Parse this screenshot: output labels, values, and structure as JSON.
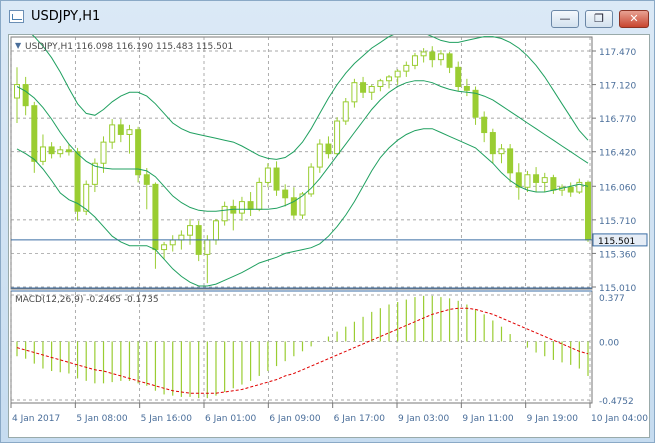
{
  "window": {
    "title": "USDJPY,H1",
    "minimize_icon": "minimize-icon",
    "restore_icon": "restore-icon",
    "close_icon": "close-icon"
  },
  "main_panel": {
    "info_label": "USDJPY,H1  116.098 116.190 115.483 115.501",
    "price_ticks": [
      "117.470",
      "117.120",
      "116.770",
      "116.420",
      "116.060",
      "115.710",
      "115.360",
      "115.010"
    ],
    "current_price": "115.501"
  },
  "macd_panel": {
    "info_label": "MACD(12,26,9) -0.2465 -0.1735",
    "ticks": [
      "0.377",
      "0.00",
      "-0.4752"
    ]
  },
  "time_axis": [
    "4 Jan 2017",
    "5 Jan 08:00",
    "5 Jan 16:00",
    "6 Jan 01:00",
    "6 Jan 09:00",
    "6 Jan 17:00",
    "9 Jan 03:00",
    "9 Jan 11:00",
    "9 Jan 19:00",
    "10 Jan 04:00"
  ],
  "colors": {
    "bull": "#9acd32",
    "bear": "#9acd32",
    "bands": "#20a060",
    "signal": "#e00000",
    "grid": "#8a8a8a",
    "axis_text": "#4a6e9a"
  },
  "chart_data": {
    "type": "candlestick",
    "price_ylim": [
      115.01,
      117.47
    ],
    "candles": [
      {
        "o": 116.98,
        "h": 117.3,
        "l": 116.72,
        "c": 117.12
      },
      {
        "o": 117.12,
        "h": 117.2,
        "l": 116.8,
        "c": 116.9
      },
      {
        "o": 116.9,
        "h": 116.94,
        "l": 116.2,
        "c": 116.32
      },
      {
        "o": 116.32,
        "h": 116.6,
        "l": 116.28,
        "c": 116.47
      },
      {
        "o": 116.47,
        "h": 116.52,
        "l": 116.35,
        "c": 116.4
      },
      {
        "o": 116.4,
        "h": 116.48,
        "l": 116.36,
        "c": 116.44
      },
      {
        "o": 116.44,
        "h": 116.5,
        "l": 116.38,
        "c": 116.42
      },
      {
        "o": 116.42,
        "h": 116.46,
        "l": 115.7,
        "c": 115.8
      },
      {
        "o": 115.8,
        "h": 116.12,
        "l": 115.76,
        "c": 116.08
      },
      {
        "o": 116.08,
        "h": 116.35,
        "l": 116.0,
        "c": 116.3
      },
      {
        "o": 116.3,
        "h": 116.58,
        "l": 116.2,
        "c": 116.52
      },
      {
        "o": 116.52,
        "h": 116.76,
        "l": 116.45,
        "c": 116.7
      },
      {
        "o": 116.7,
        "h": 116.76,
        "l": 116.52,
        "c": 116.6
      },
      {
        "o": 116.6,
        "h": 116.7,
        "l": 116.4,
        "c": 116.65
      },
      {
        "o": 116.65,
        "h": 116.68,
        "l": 116.1,
        "c": 116.18
      },
      {
        "o": 116.18,
        "h": 116.25,
        "l": 115.82,
        "c": 116.08
      },
      {
        "o": 116.08,
        "h": 116.1,
        "l": 115.2,
        "c": 115.4
      },
      {
        "o": 115.4,
        "h": 115.48,
        "l": 115.3,
        "c": 115.45
      },
      {
        "o": 115.45,
        "h": 115.55,
        "l": 115.38,
        "c": 115.5
      },
      {
        "o": 115.5,
        "h": 115.6,
        "l": 115.4,
        "c": 115.55
      },
      {
        "o": 115.55,
        "h": 115.72,
        "l": 115.45,
        "c": 115.65
      },
      {
        "o": 115.65,
        "h": 115.7,
        "l": 115.28,
        "c": 115.35
      },
      {
        "o": 115.35,
        "h": 115.55,
        "l": 115.05,
        "c": 115.5
      },
      {
        "o": 115.5,
        "h": 115.72,
        "l": 115.45,
        "c": 115.7
      },
      {
        "o": 115.7,
        "h": 115.9,
        "l": 115.65,
        "c": 115.85
      },
      {
        "o": 115.85,
        "h": 115.92,
        "l": 115.6,
        "c": 115.78
      },
      {
        "o": 115.78,
        "h": 115.95,
        "l": 115.7,
        "c": 115.9
      },
      {
        "o": 115.9,
        "h": 116.0,
        "l": 115.75,
        "c": 115.82
      },
      {
        "o": 115.82,
        "h": 116.15,
        "l": 115.8,
        "c": 116.1
      },
      {
        "o": 116.1,
        "h": 116.3,
        "l": 116.05,
        "c": 116.25
      },
      {
        "o": 116.25,
        "h": 116.32,
        "l": 115.96,
        "c": 116.02
      },
      {
        "o": 116.02,
        "h": 116.08,
        "l": 115.85,
        "c": 115.94
      },
      {
        "o": 115.94,
        "h": 116.05,
        "l": 115.72,
        "c": 115.76
      },
      {
        "o": 115.76,
        "h": 116.0,
        "l": 115.72,
        "c": 115.98
      },
      {
        "o": 115.98,
        "h": 116.3,
        "l": 115.95,
        "c": 116.26
      },
      {
        "o": 116.26,
        "h": 116.55,
        "l": 116.2,
        "c": 116.5
      },
      {
        "o": 116.5,
        "h": 116.58,
        "l": 116.35,
        "c": 116.4
      },
      {
        "o": 116.4,
        "h": 116.78,
        "l": 116.38,
        "c": 116.74
      },
      {
        "o": 116.74,
        "h": 116.98,
        "l": 116.7,
        "c": 116.94
      },
      {
        "o": 116.94,
        "h": 117.18,
        "l": 116.88,
        "c": 117.14
      },
      {
        "o": 117.14,
        "h": 117.2,
        "l": 116.98,
        "c": 117.04
      },
      {
        "o": 117.04,
        "h": 117.12,
        "l": 116.96,
        "c": 117.1
      },
      {
        "o": 117.1,
        "h": 117.18,
        "l": 117.05,
        "c": 117.16
      },
      {
        "o": 117.16,
        "h": 117.22,
        "l": 117.08,
        "c": 117.2
      },
      {
        "o": 117.2,
        "h": 117.28,
        "l": 117.12,
        "c": 117.26
      },
      {
        "o": 117.26,
        "h": 117.36,
        "l": 117.2,
        "c": 117.32
      },
      {
        "o": 117.32,
        "h": 117.45,
        "l": 117.28,
        "c": 117.42
      },
      {
        "o": 117.42,
        "h": 117.5,
        "l": 117.35,
        "c": 117.46
      },
      {
        "o": 117.46,
        "h": 117.52,
        "l": 117.3,
        "c": 117.38
      },
      {
        "o": 117.38,
        "h": 117.48,
        "l": 117.32,
        "c": 117.44
      },
      {
        "o": 117.44,
        "h": 117.46,
        "l": 117.24,
        "c": 117.3
      },
      {
        "o": 117.3,
        "h": 117.36,
        "l": 117.05,
        "c": 117.1
      },
      {
        "o": 117.1,
        "h": 117.18,
        "l": 117.0,
        "c": 117.06
      },
      {
        "o": 117.06,
        "h": 117.1,
        "l": 116.7,
        "c": 116.78
      },
      {
        "o": 116.78,
        "h": 116.84,
        "l": 116.52,
        "c": 116.62
      },
      {
        "o": 116.62,
        "h": 116.66,
        "l": 116.3,
        "c": 116.4
      },
      {
        "o": 116.4,
        "h": 116.5,
        "l": 116.3,
        "c": 116.45
      },
      {
        "o": 116.45,
        "h": 116.5,
        "l": 116.1,
        "c": 116.2
      },
      {
        "o": 116.2,
        "h": 116.3,
        "l": 115.92,
        "c": 116.05
      },
      {
        "o": 116.05,
        "h": 116.22,
        "l": 116.0,
        "c": 116.18
      },
      {
        "o": 116.18,
        "h": 116.26,
        "l": 116.0,
        "c": 116.1
      },
      {
        "o": 116.1,
        "h": 116.2,
        "l": 116.0,
        "c": 116.15
      },
      {
        "o": 116.15,
        "h": 116.18,
        "l": 115.98,
        "c": 116.02
      },
      {
        "o": 116.02,
        "h": 116.08,
        "l": 115.96,
        "c": 116.05
      },
      {
        "o": 116.05,
        "h": 116.1,
        "l": 115.95,
        "c": 116.0
      },
      {
        "o": 116.0,
        "h": 116.14,
        "l": 115.98,
        "c": 116.1
      },
      {
        "o": 116.1,
        "h": 116.12,
        "l": 115.48,
        "c": 115.5
      }
    ],
    "bb_upper": [
      117.75,
      117.7,
      117.62,
      117.52,
      117.4,
      117.25,
      117.08,
      116.92,
      116.82,
      116.8,
      116.86,
      116.94,
      117.0,
      117.04,
      117.04,
      117.0,
      116.92,
      116.82,
      116.72,
      116.66,
      116.62,
      116.6,
      116.58,
      116.56,
      116.54,
      116.52,
      116.48,
      116.43,
      116.38,
      116.35,
      116.34,
      116.36,
      116.42,
      116.52,
      116.66,
      116.82,
      116.98,
      117.12,
      117.24,
      117.34,
      117.42,
      117.5,
      117.56,
      117.62,
      117.66,
      117.68,
      117.68,
      117.66,
      117.62,
      117.58,
      117.56,
      117.56,
      117.58,
      117.6,
      117.62,
      117.62,
      117.6,
      117.56,
      117.5,
      117.42,
      117.32,
      117.2,
      117.06,
      116.92,
      116.78,
      116.64,
      116.54
    ],
    "bb_middle": [
      117.1,
      117.05,
      116.98,
      116.88,
      116.76,
      116.62,
      116.5,
      116.4,
      116.32,
      116.27,
      116.25,
      116.24,
      116.24,
      116.24,
      116.24,
      116.22,
      116.16,
      116.06,
      115.96,
      115.89,
      115.84,
      115.81,
      115.8,
      115.8,
      115.81,
      115.82,
      115.82,
      115.82,
      115.82,
      115.82,
      115.83,
      115.86,
      115.9,
      115.96,
      116.04,
      116.14,
      116.26,
      116.38,
      116.5,
      116.62,
      116.74,
      116.86,
      116.96,
      117.04,
      117.1,
      117.14,
      117.16,
      117.16,
      117.14,
      117.1,
      117.07,
      117.05,
      117.04,
      117.03,
      117.0,
      116.96,
      116.9,
      116.84,
      116.78,
      116.72,
      116.66,
      116.6,
      116.54,
      116.48,
      116.42,
      116.36,
      116.3
    ],
    "bb_lower": [
      116.45,
      116.4,
      116.34,
      116.24,
      116.12,
      115.99,
      115.92,
      115.88,
      115.82,
      115.74,
      115.64,
      115.54,
      115.48,
      115.44,
      115.44,
      115.44,
      115.4,
      115.3,
      115.2,
      115.12,
      115.06,
      115.02,
      115.02,
      115.04,
      115.08,
      115.12,
      115.16,
      115.21,
      115.26,
      115.29,
      115.32,
      115.36,
      115.38,
      115.4,
      115.42,
      115.46,
      115.54,
      115.64,
      115.76,
      115.9,
      116.06,
      116.22,
      116.36,
      116.46,
      116.54,
      116.6,
      116.64,
      116.66,
      116.66,
      116.62,
      116.58,
      116.54,
      116.5,
      116.46,
      116.38,
      116.3,
      116.2,
      116.12,
      116.06,
      116.02,
      116.0,
      116.0,
      116.02,
      116.04,
      116.06,
      116.08,
      116.06
    ],
    "macd_ylim": [
      -0.4752,
      0.377
    ],
    "macd_hist": [
      -0.12,
      -0.14,
      -0.18,
      -0.22,
      -0.24,
      -0.25,
      -0.26,
      -0.3,
      -0.32,
      -0.34,
      -0.34,
      -0.33,
      -0.32,
      -0.32,
      -0.34,
      -0.36,
      -0.4,
      -0.43,
      -0.44,
      -0.45,
      -0.45,
      -0.46,
      -0.46,
      -0.44,
      -0.41,
      -0.38,
      -0.35,
      -0.32,
      -0.28,
      -0.24,
      -0.2,
      -0.16,
      -0.12,
      -0.08,
      -0.04,
      0.0,
      0.04,
      0.08,
      0.12,
      0.16,
      0.2,
      0.24,
      0.27,
      0.3,
      0.32,
      0.34,
      0.36,
      0.37,
      0.37,
      0.36,
      0.35,
      0.33,
      0.3,
      0.26,
      0.22,
      0.17,
      0.12,
      0.06,
      0.0,
      -0.05,
      -0.09,
      -0.12,
      -0.15,
      -0.17,
      -0.19,
      -0.22,
      -0.28
    ],
    "macd_signal": [
      -0.05,
      -0.07,
      -0.09,
      -0.11,
      -0.13,
      -0.15,
      -0.17,
      -0.19,
      -0.21,
      -0.23,
      -0.24,
      -0.26,
      -0.28,
      -0.3,
      -0.32,
      -0.34,
      -0.36,
      -0.38,
      -0.4,
      -0.41,
      -0.42,
      -0.42,
      -0.42,
      -0.42,
      -0.41,
      -0.4,
      -0.39,
      -0.37,
      -0.35,
      -0.33,
      -0.31,
      -0.28,
      -0.26,
      -0.23,
      -0.2,
      -0.17,
      -0.14,
      -0.11,
      -0.08,
      -0.05,
      -0.02,
      0.01,
      0.04,
      0.07,
      0.1,
      0.13,
      0.16,
      0.19,
      0.22,
      0.24,
      0.26,
      0.27,
      0.27,
      0.26,
      0.24,
      0.22,
      0.19,
      0.16,
      0.13,
      0.1,
      0.07,
      0.04,
      0.01,
      -0.02,
      -0.05,
      -0.08,
      -0.1
    ]
  }
}
